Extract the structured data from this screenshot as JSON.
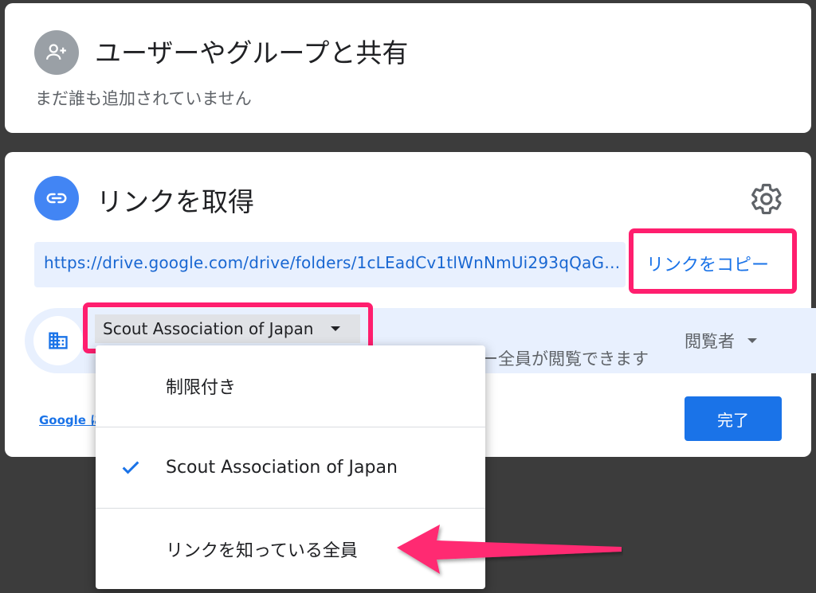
{
  "share": {
    "title": "ユーザーやグループと共有",
    "subtitle": "まだ誰も追加されていません",
    "icon": "person-add-icon"
  },
  "link": {
    "title": "リンクを取得",
    "icon": "link-icon",
    "url": "https://drive.google.com/drive/folders/1cLEadCv1tlWnNmUi293qQaG…",
    "copy_label": "リンクをコピー",
    "settings_icon": "gear-icon"
  },
  "access": {
    "org_icon": "building-icon",
    "selected": "Scout Association of Japan",
    "description_visible": "ー全員が閲覧できます",
    "role": "閲覧者"
  },
  "footer": {
    "google_link": "Google に",
    "done_label": "完了"
  },
  "menu": {
    "items": [
      {
        "label": "制限付き",
        "checked": false
      },
      {
        "label": "Scout Association of Japan",
        "checked": true
      },
      {
        "label": "リンクを知っている全員",
        "checked": false
      }
    ]
  },
  "colors": {
    "accent": "#1a73e8",
    "highlight": "#ff1e6e",
    "background": "#3c3c3c"
  }
}
